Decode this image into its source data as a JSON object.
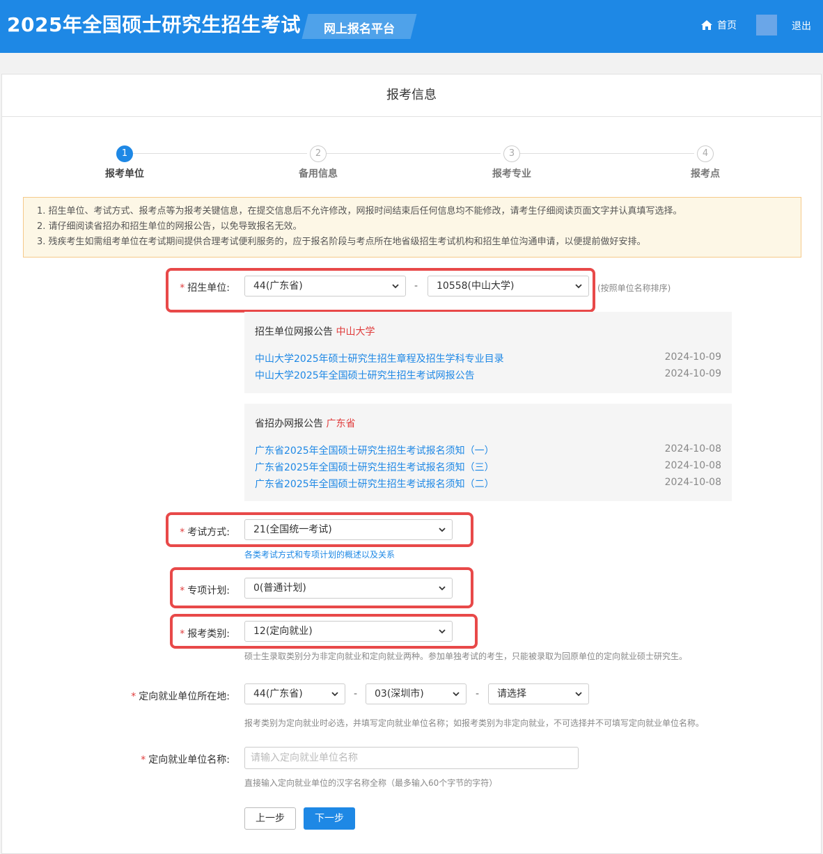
{
  "header": {
    "site_title": "2025年全国硕士研究生招生考试",
    "platform_label": "网上报名平台",
    "home_label": "首页",
    "logout_label": "退出"
  },
  "panel": {
    "title": "报考信息"
  },
  "steps": [
    {
      "num": "1",
      "label": "报考单位",
      "active": true
    },
    {
      "num": "2",
      "label": "备用信息",
      "active": false
    },
    {
      "num": "3",
      "label": "报考专业",
      "active": false
    },
    {
      "num": "4",
      "label": "报考点",
      "active": false
    }
  ],
  "notice": [
    "1. 招生单位、考试方式、报考点等为报考关键信息，在提交信息后不允许修改，网报时间结束后任何信息均不能修改，请考生仔细阅读页面文字并认真填写选择。",
    "2. 请仔细阅读省招办和招生单位的网报公告，以免导致报名无效。",
    "3. 残疾考生如需组考单位在考试期间提供合理考试便利服务的，应于报名阶段与考点所在地省级招生考试机构和招生单位沟通申请，以便提前做好安排。"
  ],
  "form": {
    "required_mark": "*",
    "unit": {
      "label": "招生单位:",
      "province": "44(广东省)",
      "school": "10558(中山大学)",
      "separator": "-",
      "hint": "(按照单位名称排序)"
    },
    "unit_announcements": {
      "title": "招生单位网报公告",
      "name": "中山大学",
      "items": [
        {
          "text": "中山大学2025年硕士研究生招生章程及招生学科专业目录",
          "date": "2024-10-09"
        },
        {
          "text": "中山大学2025年全国硕士研究生招生考试网报公告",
          "date": "2024-10-09"
        }
      ]
    },
    "province_announcements": {
      "title": "省招办网报公告",
      "name": "广东省",
      "items": [
        {
          "text": "广东省2025年全国硕士研究生招生考试报名须知（一）",
          "date": "2024-10-08"
        },
        {
          "text": "广东省2025年全国硕士研究生招生考试报名须知（三）",
          "date": "2024-10-08"
        },
        {
          "text": "广东省2025年全国硕士研究生招生考试报名须知（二）",
          "date": "2024-10-08"
        }
      ]
    },
    "exam_mode": {
      "label": "考试方式:",
      "value": "21(全国统一考试)",
      "link": "各类考试方式和专项计划的概述以及关系"
    },
    "special_plan": {
      "label": "专项计划:",
      "value": "0(普通计划)"
    },
    "category": {
      "label": "报考类别:",
      "value": "12(定向就业)",
      "hint": "硕士生录取类别分为非定向就业和定向就业两种。参加单独考试的考生，只能被录取为回原单位的定向就业硕士研究生。"
    },
    "employer_location": {
      "label": "定向就业单位所在地:",
      "province": "44(广东省)",
      "city": "03(深圳市)",
      "district": "请选择",
      "hint": "报考类别为定向就业时必选，并填写定向就业单位名称；如报考类别为非定向就业，不可选择并不可填写定向就业单位名称。"
    },
    "employer_name": {
      "label": "定向就业单位名称:",
      "placeholder": "请输入定向就业单位名称",
      "hint": "直接输入定向就业单位的汉字名称全称（最多输入60个字节的字符）"
    }
  },
  "buttons": {
    "prev": "上一步",
    "next": "下一步"
  },
  "colors": {
    "primary": "#1e88e5",
    "highlight": "#e84949",
    "required": "#e03c3c",
    "notice_bg": "#fdf7e6"
  }
}
